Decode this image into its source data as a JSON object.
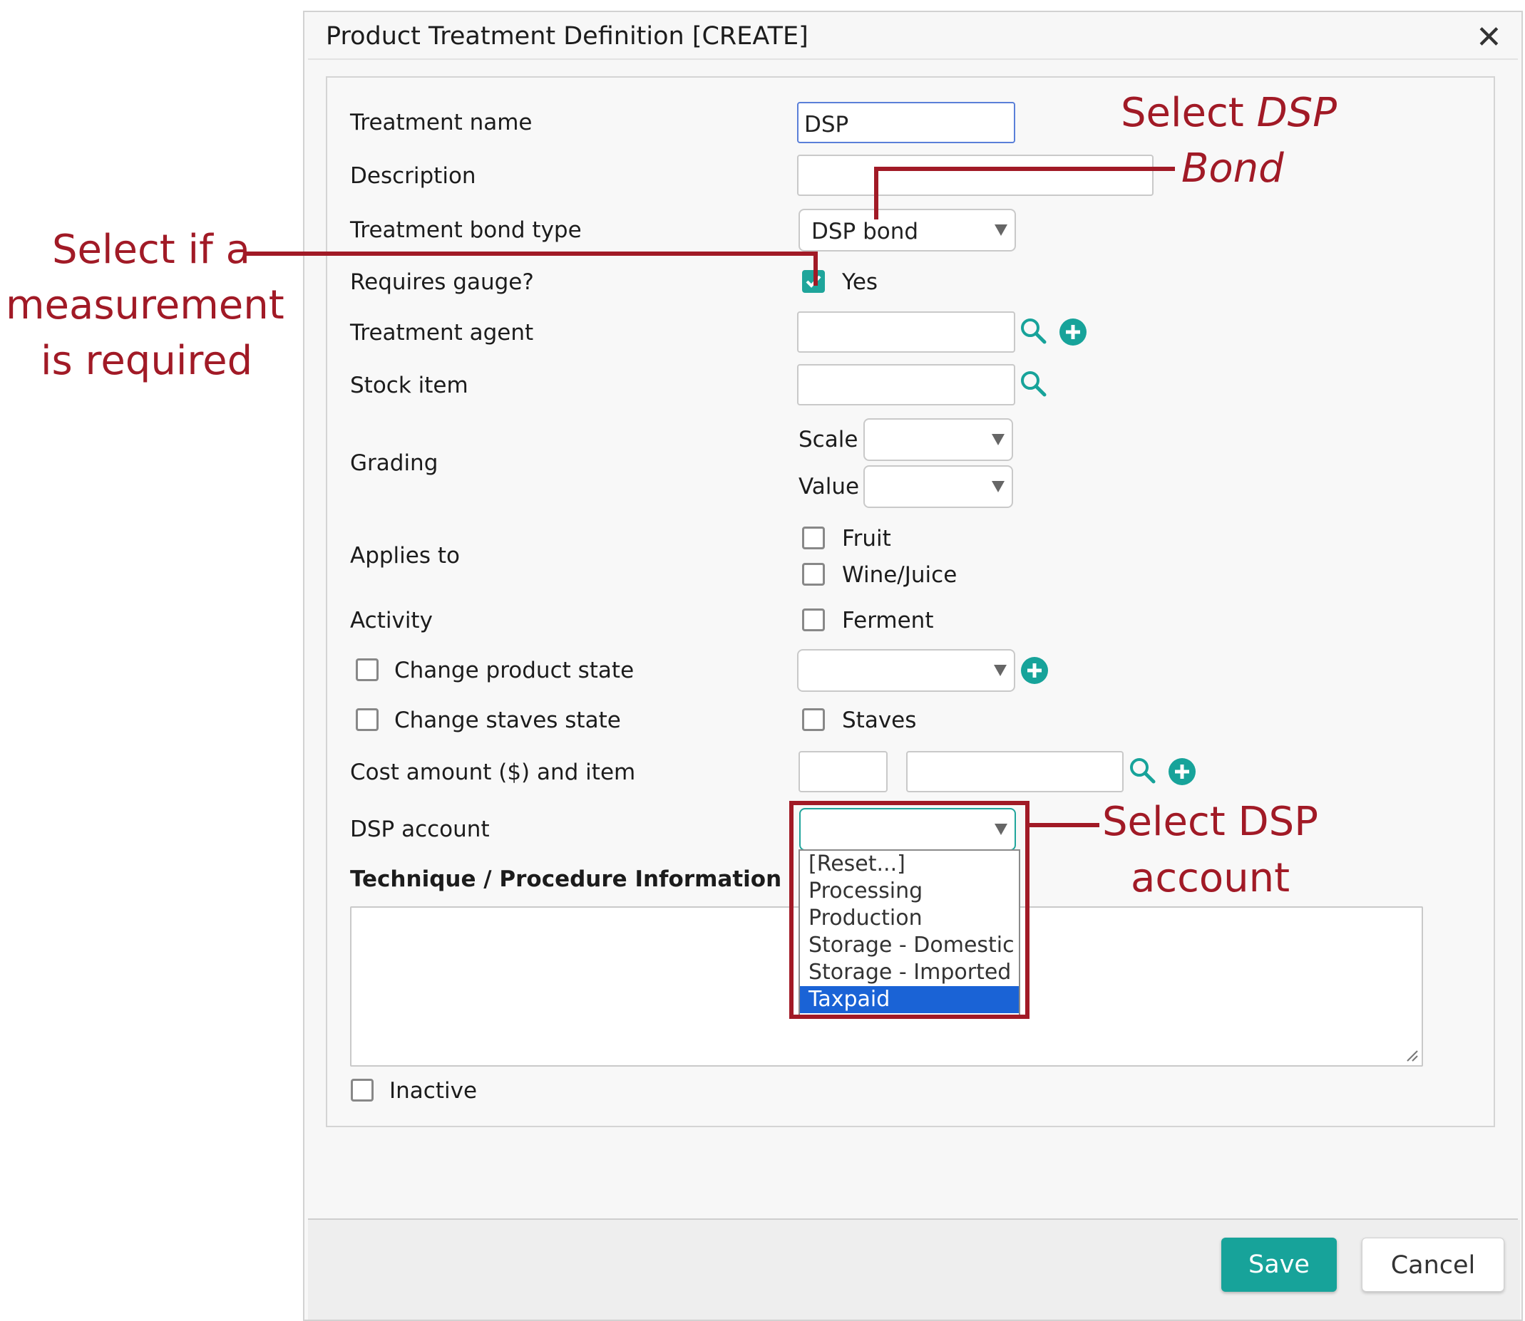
{
  "dialog": {
    "title": "Product Treatment Definition [CREATE]",
    "close_symbol": "✕"
  },
  "form": {
    "treatment_name": {
      "label": "Treatment name",
      "value": "DSP"
    },
    "description": {
      "label": "Description",
      "value": ""
    },
    "bond_type": {
      "label": "Treatment bond type",
      "value": "DSP bond"
    },
    "requires_gauge": {
      "label": "Requires gauge?",
      "option": "Yes",
      "checked": true
    },
    "treatment_agent": {
      "label": "Treatment agent",
      "value": ""
    },
    "stock_item": {
      "label": "Stock item",
      "value": ""
    },
    "grading": {
      "label": "Grading",
      "scale_label": "Scale",
      "value_label": "Value"
    },
    "applies_to": {
      "label": "Applies to",
      "options": [
        "Fruit",
        "Wine/Juice"
      ]
    },
    "activity": {
      "label": "Activity",
      "option": "Ferment"
    },
    "change_product_state": {
      "label": "Change product state"
    },
    "change_staves_state": {
      "label": "Change staves state",
      "option": "Staves"
    },
    "cost": {
      "label": "Cost amount ($) and item"
    },
    "dsp_account": {
      "label": "DSP account",
      "options": [
        "[Reset...]",
        "Processing",
        "Production",
        "Storage - Domestic",
        "Storage - Imported",
        "Taxpaid"
      ],
      "highlighted": "Taxpaid"
    },
    "technique": {
      "label": "Technique / Procedure Information"
    },
    "inactive": {
      "label": "Inactive"
    }
  },
  "buttons": {
    "save": "Save",
    "cancel": "Cancel"
  },
  "annotations": {
    "dsp_bond_line1_normal": "Select ",
    "dsp_bond_line1_italic": "DSP",
    "dsp_bond_line2_italic": "Bond",
    "gauge_line1": "Select if a",
    "gauge_line2": "measurement",
    "gauge_line3": "is required",
    "account_line1": "Select DSP",
    "account_line2": "account"
  },
  "colors": {
    "accent_teal": "#1fa59b",
    "annotation_red": "#a11a26",
    "selected_option_blue": "#1a63d6"
  },
  "icons": [
    "search-icon",
    "add-icon",
    "close-icon",
    "check-icon",
    "resize-handle-icon"
  ]
}
